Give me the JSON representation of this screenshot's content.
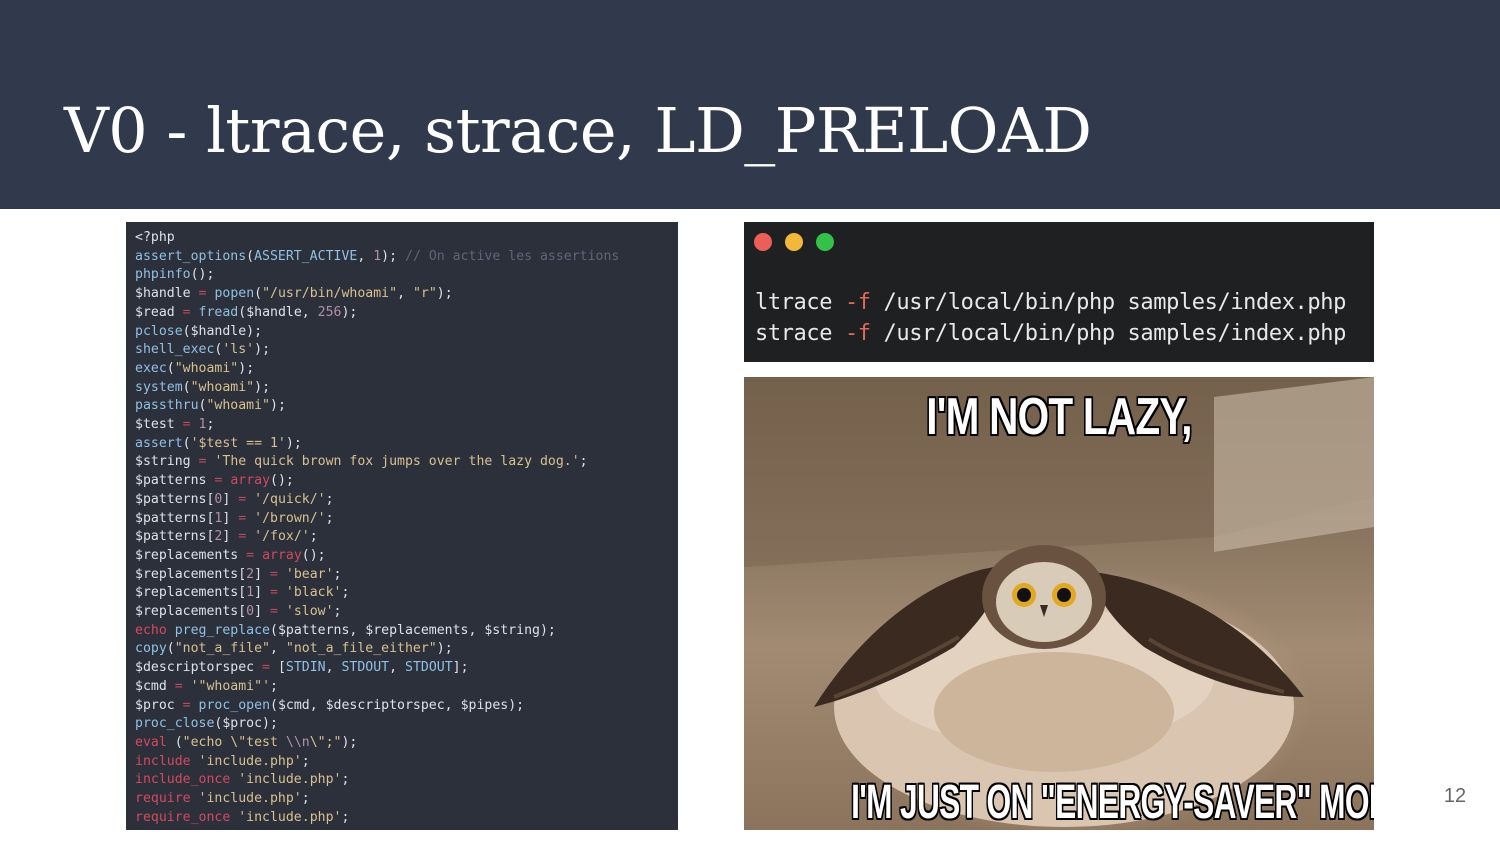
{
  "slide": {
    "title": "V0 - ltrace, strace, LD_PRELOAD",
    "page_number": "12"
  },
  "code_panel": {
    "language": "php",
    "lines": [
      [
        [
          "plain",
          "<?php"
        ]
      ],
      [
        [
          "func",
          "assert_options"
        ],
        [
          "plain",
          "("
        ],
        [
          "const",
          "ASSERT_ACTIVE"
        ],
        [
          "plain",
          ", "
        ],
        [
          "number",
          "1"
        ],
        [
          "plain",
          "); "
        ],
        [
          "comment",
          "// On active les assertions"
        ]
      ],
      [
        [
          "func",
          "phpinfo"
        ],
        [
          "plain",
          "();"
        ]
      ],
      [
        [
          "plain",
          "$handle "
        ],
        [
          "operator",
          "="
        ],
        [
          "plain",
          " "
        ],
        [
          "func",
          "popen"
        ],
        [
          "plain",
          "("
        ],
        [
          "string",
          "\"/usr/bin/whoami\""
        ],
        [
          "plain",
          ", "
        ],
        [
          "string",
          "\"r\""
        ],
        [
          "plain",
          ");"
        ]
      ],
      [
        [
          "plain",
          "$read "
        ],
        [
          "operator",
          "="
        ],
        [
          "plain",
          " "
        ],
        [
          "func",
          "fread"
        ],
        [
          "plain",
          "($handle, "
        ],
        [
          "number",
          "256"
        ],
        [
          "plain",
          ");"
        ]
      ],
      [
        [
          "func",
          "pclose"
        ],
        [
          "plain",
          "($handle);"
        ]
      ],
      [
        [
          "func",
          "shell_exec"
        ],
        [
          "plain",
          "("
        ],
        [
          "string",
          "'ls'"
        ],
        [
          "plain",
          ");"
        ]
      ],
      [
        [
          "func",
          "exec"
        ],
        [
          "plain",
          "("
        ],
        [
          "string",
          "\"whoami\""
        ],
        [
          "plain",
          ");"
        ]
      ],
      [
        [
          "func",
          "system"
        ],
        [
          "plain",
          "("
        ],
        [
          "string",
          "\"whoami\""
        ],
        [
          "plain",
          ");"
        ]
      ],
      [
        [
          "func",
          "passthru"
        ],
        [
          "plain",
          "("
        ],
        [
          "string",
          "\"whoami\""
        ],
        [
          "plain",
          ");"
        ]
      ],
      [
        [
          "plain",
          "$test "
        ],
        [
          "operator",
          "="
        ],
        [
          "plain",
          " "
        ],
        [
          "number",
          "1"
        ],
        [
          "plain",
          ";"
        ]
      ],
      [
        [
          "func",
          "assert"
        ],
        [
          "plain",
          "("
        ],
        [
          "string",
          "'$test == 1'"
        ],
        [
          "plain",
          ");"
        ]
      ],
      [
        [
          "plain",
          "$string "
        ],
        [
          "operator",
          "="
        ],
        [
          "plain",
          " "
        ],
        [
          "string",
          "'The quick brown fox jumps over the lazy dog.'"
        ],
        [
          "plain",
          ";"
        ]
      ],
      [
        [
          "plain",
          "$patterns "
        ],
        [
          "operator",
          "="
        ],
        [
          "plain",
          " "
        ],
        [
          "keyword",
          "array"
        ],
        [
          "plain",
          "();"
        ]
      ],
      [
        [
          "plain",
          "$patterns["
        ],
        [
          "number",
          "0"
        ],
        [
          "plain",
          "] "
        ],
        [
          "operator",
          "="
        ],
        [
          "plain",
          " "
        ],
        [
          "string",
          "'/quick/'"
        ],
        [
          "plain",
          ";"
        ]
      ],
      [
        [
          "plain",
          "$patterns["
        ],
        [
          "number",
          "1"
        ],
        [
          "plain",
          "] "
        ],
        [
          "operator",
          "="
        ],
        [
          "plain",
          " "
        ],
        [
          "string",
          "'/brown/'"
        ],
        [
          "plain",
          ";"
        ]
      ],
      [
        [
          "plain",
          "$patterns["
        ],
        [
          "number",
          "2"
        ],
        [
          "plain",
          "] "
        ],
        [
          "operator",
          "="
        ],
        [
          "plain",
          " "
        ],
        [
          "string",
          "'/fox/'"
        ],
        [
          "plain",
          ";"
        ]
      ],
      [
        [
          "plain",
          "$replacements "
        ],
        [
          "operator",
          "="
        ],
        [
          "plain",
          " "
        ],
        [
          "keyword",
          "array"
        ],
        [
          "plain",
          "();"
        ]
      ],
      [
        [
          "plain",
          "$replacements["
        ],
        [
          "number",
          "2"
        ],
        [
          "plain",
          "] "
        ],
        [
          "operator",
          "="
        ],
        [
          "plain",
          " "
        ],
        [
          "string",
          "'bear'"
        ],
        [
          "plain",
          ";"
        ]
      ],
      [
        [
          "plain",
          "$replacements["
        ],
        [
          "number",
          "1"
        ],
        [
          "plain",
          "] "
        ],
        [
          "operator",
          "="
        ],
        [
          "plain",
          " "
        ],
        [
          "string",
          "'black'"
        ],
        [
          "plain",
          ";"
        ]
      ],
      [
        [
          "plain",
          "$replacements["
        ],
        [
          "number",
          "0"
        ],
        [
          "plain",
          "] "
        ],
        [
          "operator",
          "="
        ],
        [
          "plain",
          " "
        ],
        [
          "string",
          "'slow'"
        ],
        [
          "plain",
          ";"
        ]
      ],
      [
        [
          "keyword",
          "echo"
        ],
        [
          "plain",
          " "
        ],
        [
          "func",
          "preg_replace"
        ],
        [
          "plain",
          "($patterns, $replacements, $string);"
        ]
      ],
      [
        [
          "func",
          "copy"
        ],
        [
          "plain",
          "("
        ],
        [
          "string",
          "\"not_a_file\""
        ],
        [
          "plain",
          ", "
        ],
        [
          "string",
          "\"not_a_file_either\""
        ],
        [
          "plain",
          ");"
        ]
      ],
      [
        [
          "plain",
          "$descriptorspec "
        ],
        [
          "operator",
          "="
        ],
        [
          "plain",
          " ["
        ],
        [
          "const",
          "STDIN"
        ],
        [
          "plain",
          ", "
        ],
        [
          "const",
          "STDOUT"
        ],
        [
          "plain",
          ", "
        ],
        [
          "const",
          "STDOUT"
        ],
        [
          "plain",
          "];"
        ]
      ],
      [
        [
          "plain",
          "$cmd "
        ],
        [
          "operator",
          "="
        ],
        [
          "plain",
          " "
        ],
        [
          "string",
          "'\"whoami\"'"
        ],
        [
          "plain",
          ";"
        ]
      ],
      [
        [
          "plain",
          "$proc "
        ],
        [
          "operator",
          "="
        ],
        [
          "plain",
          " "
        ],
        [
          "func",
          "proc_open"
        ],
        [
          "plain",
          "($cmd, $descriptorspec, $pipes);"
        ]
      ],
      [
        [
          "func",
          "proc_close"
        ],
        [
          "plain",
          "($proc);"
        ]
      ],
      [
        [
          "keyword",
          "eval"
        ],
        [
          "plain",
          " ("
        ],
        [
          "string",
          "\"echo \\\"test "
        ],
        [
          "number",
          "\\\\n"
        ],
        [
          "string",
          "\\\";\""
        ],
        [
          "plain",
          ");"
        ]
      ],
      [
        [
          "keyword",
          "include"
        ],
        [
          "plain",
          " "
        ],
        [
          "string",
          "'include.php'"
        ],
        [
          "plain",
          ";"
        ]
      ],
      [
        [
          "keyword",
          "include_once"
        ],
        [
          "plain",
          " "
        ],
        [
          "string",
          "'include.php'"
        ],
        [
          "plain",
          ";"
        ]
      ],
      [
        [
          "keyword",
          "require"
        ],
        [
          "plain",
          " "
        ],
        [
          "string",
          "'include.php'"
        ],
        [
          "plain",
          ";"
        ]
      ],
      [
        [
          "keyword",
          "require_once"
        ],
        [
          "plain",
          " "
        ],
        [
          "string",
          "'include.php'"
        ],
        [
          "plain",
          ";"
        ]
      ]
    ]
  },
  "terminal": {
    "lines": [
      {
        "cmd": "ltrace",
        "flag": "-f",
        "args": "/usr/local/bin/php samples/index.php"
      },
      {
        "cmd": "strace",
        "flag": "-f",
        "args": "/usr/local/bin/php samples/index.php"
      }
    ],
    "colors": {
      "close": "#ec5f59",
      "minimize": "#f3b73a",
      "maximize": "#32c24a"
    }
  },
  "meme": {
    "top_text": "I'M NOT LAZY,",
    "bottom_text": "I'M JUST ON \"ENERGY-SAVER\" MODE.",
    "subject": "owl-photo"
  },
  "colors": {
    "header_bg": "#313a4d",
    "code_bg": "#2b303b"
  }
}
